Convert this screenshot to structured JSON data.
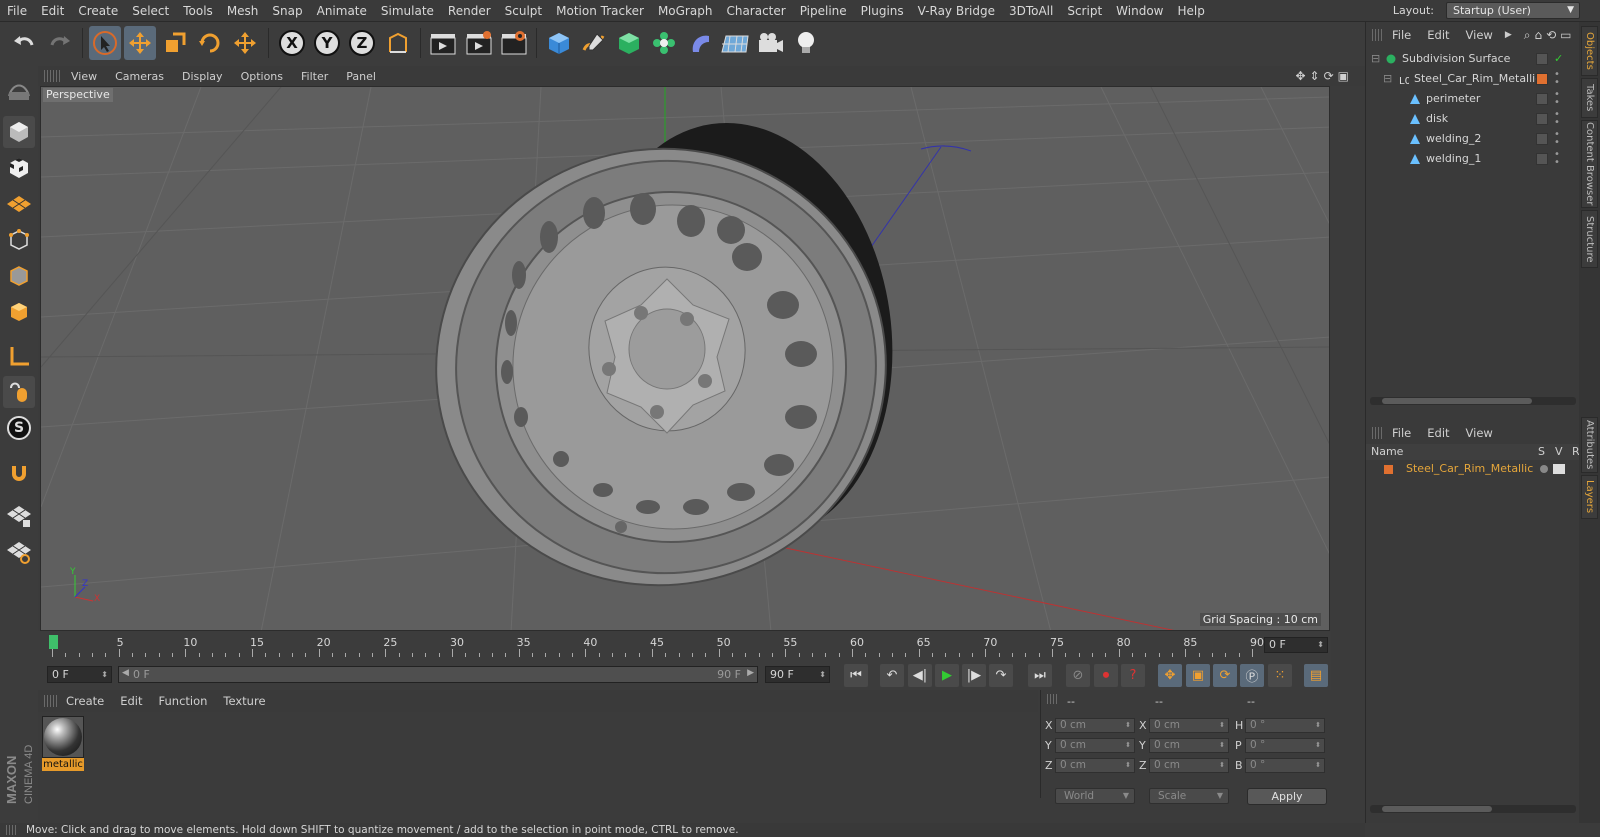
{
  "menubar": {
    "items": [
      "File",
      "Edit",
      "Create",
      "Select",
      "Tools",
      "Mesh",
      "Snap",
      "Animate",
      "Simulate",
      "Render",
      "Sculpt",
      "Motion Tracker",
      "MoGraph",
      "Character",
      "Pipeline",
      "Plugins",
      "V-Ray Bridge",
      "3DToAll",
      "Script",
      "Window",
      "Help"
    ],
    "layout_label": "Layout:",
    "layout_value": "Startup (User)"
  },
  "toolbar": {
    "axis_x": "X",
    "axis_y": "Y",
    "axis_z": "Z"
  },
  "viewport": {
    "menu": [
      "View",
      "Cameras",
      "Display",
      "Options",
      "Filter",
      "Panel"
    ],
    "label": "Perspective",
    "grid_spacing": "Grid Spacing : 10 cm",
    "axis_y": "Y",
    "axis_z": "Z",
    "axis_x": "X"
  },
  "timeline": {
    "ticks": [
      "0",
      "5",
      "10",
      "15",
      "20",
      "25",
      "30",
      "35",
      "40",
      "45",
      "50",
      "55",
      "60",
      "65",
      "70",
      "75",
      "80",
      "85",
      "90"
    ],
    "end_frame_field": "0 F",
    "current_frame": "0 F",
    "range_start": "0 F",
    "range_end": "90 F",
    "max_frame": "90 F"
  },
  "material_manager": {
    "menu": [
      "Create",
      "Edit",
      "Function",
      "Texture"
    ],
    "material_name": "metallic"
  },
  "coordinates": {
    "header_left": "--",
    "header_mid": "--",
    "header_right": "--",
    "rows": [
      {
        "l1": "X",
        "v1": "0 cm",
        "l2": "X",
        "v2": "0 cm",
        "l3": "H",
        "v3": "0 °"
      },
      {
        "l1": "Y",
        "v1": "0 cm",
        "l2": "Y",
        "v2": "0 cm",
        "l3": "P",
        "v3": "0 °"
      },
      {
        "l1": "Z",
        "v1": "0 cm",
        "l2": "Z",
        "v2": "0 cm",
        "l3": "B",
        "v3": "0 °"
      }
    ],
    "space_select": "World",
    "mode_select": "Scale",
    "apply_label": "Apply"
  },
  "status": {
    "text": "Move: Click and drag to move elements. Hold down SHIFT to quantize movement / add to the selection in point mode, CTRL to remove."
  },
  "object_manager": {
    "menu": [
      "File",
      "Edit",
      "View"
    ],
    "objects": [
      {
        "name": "Subdivision Surface"
      },
      {
        "name": "Steel_Car_Rim_Metallic"
      },
      {
        "name": "perimeter"
      },
      {
        "name": "disk"
      },
      {
        "name": "welding_2"
      },
      {
        "name": "welding_1"
      }
    ]
  },
  "layer_manager": {
    "menu": [
      "File",
      "Edit",
      "View"
    ],
    "col_name": "Name",
    "col_s": "S",
    "col_v": "V",
    "col_r": "R",
    "layer_name": "Steel_Car_Rim_Metallic"
  },
  "side_tabs": [
    "Objects",
    "Takes",
    "Content Browser",
    "Structure",
    "Attributes",
    "Layers"
  ],
  "brand": {
    "maxon": "MAXON",
    "product": "CINEMA 4D"
  },
  "colors": {
    "accent_orange": "#e5a63a",
    "selection_blue": "#5a6a7a",
    "viewport_bg": "#5f5f5f"
  }
}
